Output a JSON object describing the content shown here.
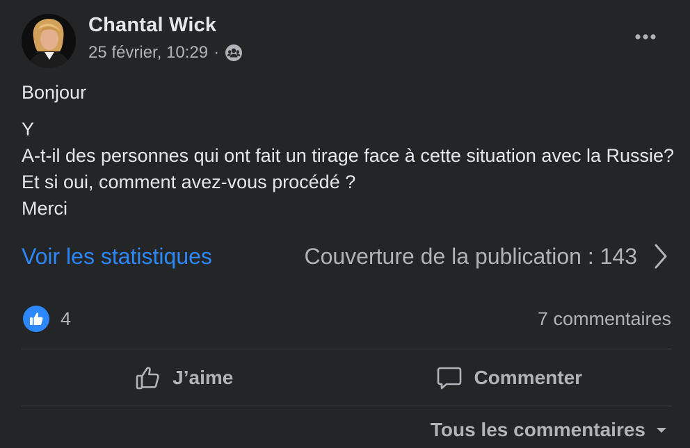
{
  "post": {
    "author": "Chantal Wick",
    "timestamp": "25 février, 10:29",
    "separator": "·",
    "audience_icon": "group-audience-icon",
    "lines": [
      "Bonjour",
      "Y",
      "A-t-il des personnes qui ont fait un tirage face à cette situation avec la Russie? Et si oui, comment avez-vous procédé ?",
      "Merci"
    ]
  },
  "insights": {
    "link_label": "Voir les statistiques",
    "reach_label": "Couverture de la publication : 143"
  },
  "engagement": {
    "reaction_count": "4",
    "comments_label": "7 commentaires"
  },
  "actions": {
    "like_label": "J’aime",
    "comment_label": "Commenter"
  },
  "comments": {
    "sort_label": "Tous les commentaires"
  },
  "colors": {
    "background": "#242526",
    "primary_text": "#e4e6eb",
    "secondary_text": "#b0b3b8",
    "accent": "#2d88ff",
    "divider": "#3e4042"
  }
}
